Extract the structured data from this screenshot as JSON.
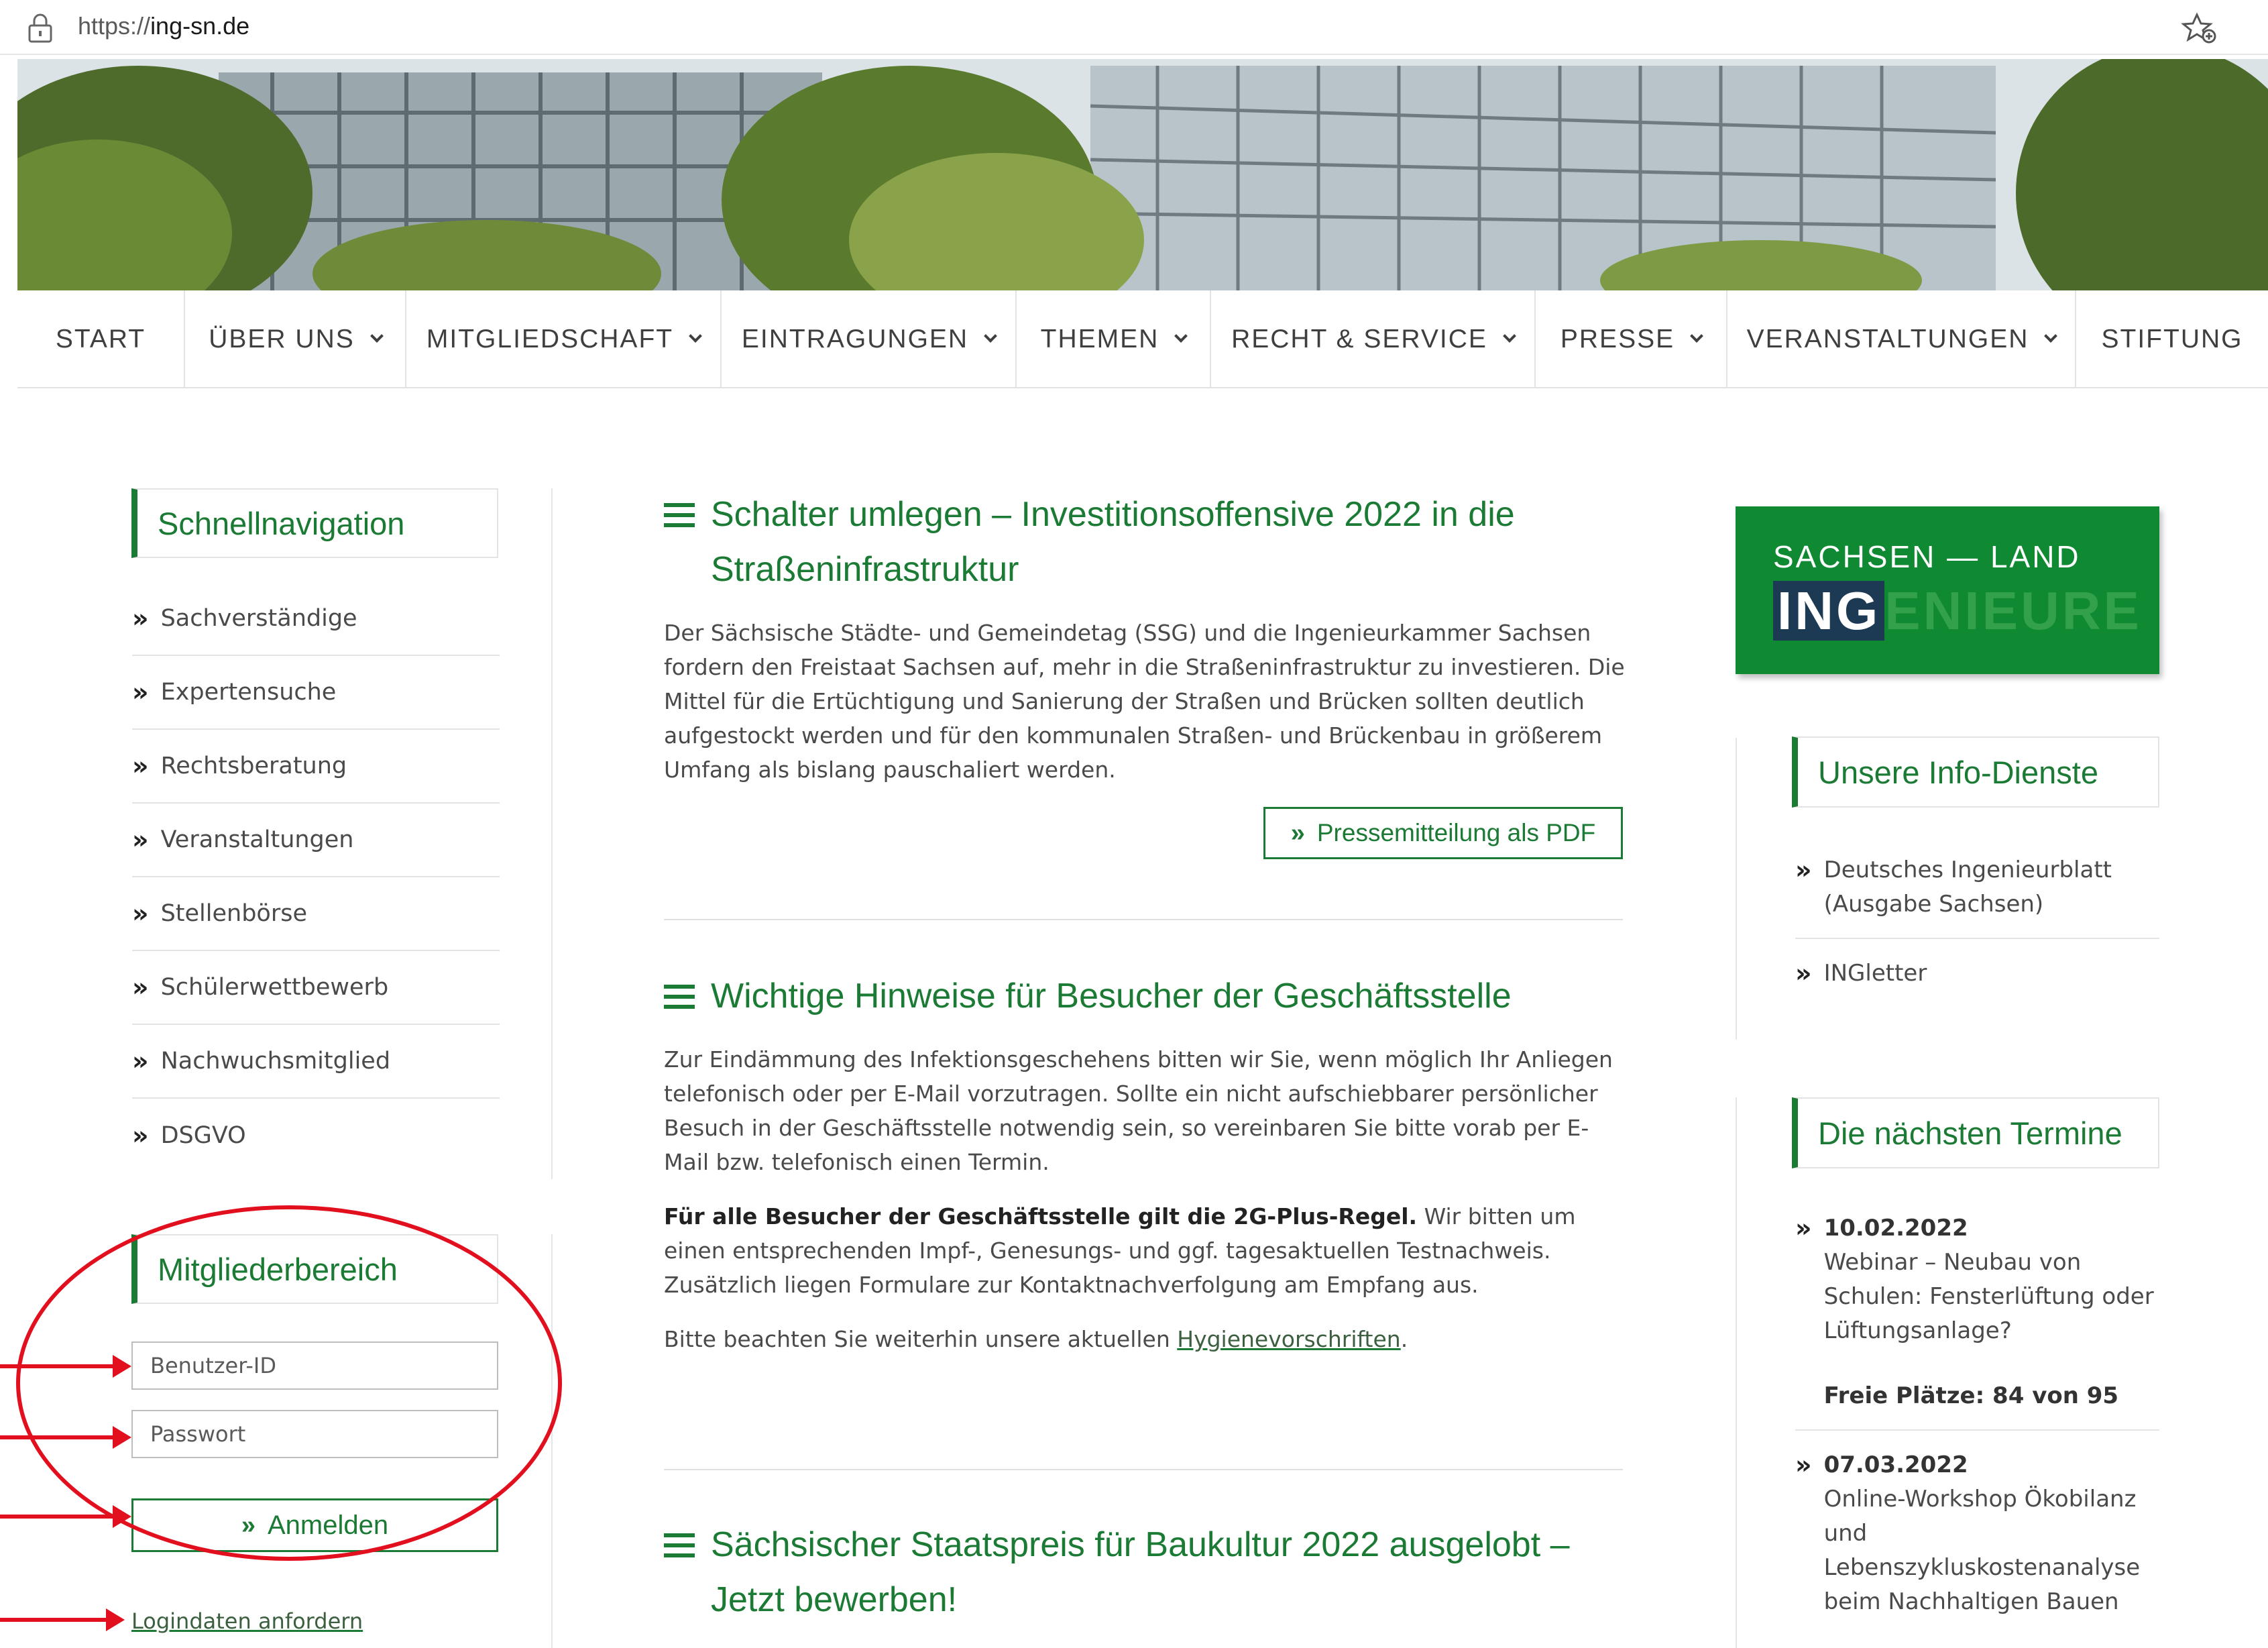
{
  "browser": {
    "url_scheme": "https://",
    "url_host": "ing-sn.de"
  },
  "nav": [
    {
      "label": "START",
      "dropdown": false
    },
    {
      "label": "ÜBER UNS",
      "dropdown": true
    },
    {
      "label": "MITGLIEDSCHAFT",
      "dropdown": true
    },
    {
      "label": "EINTRAGUNGEN",
      "dropdown": true
    },
    {
      "label": "THEMEN",
      "dropdown": true
    },
    {
      "label": "RECHT & SERVICE",
      "dropdown": true
    },
    {
      "label": "PRESSE",
      "dropdown": true
    },
    {
      "label": "VERANSTALTUNGEN",
      "dropdown": true
    },
    {
      "label": "STIFTUNG",
      "dropdown": false
    }
  ],
  "quicknav": {
    "title": "Schnellnavigation",
    "items": [
      "Sachverständige",
      "Expertensuche",
      "Rechtsberatung",
      "Veranstaltungen",
      "Stellenbörse",
      "Schülerwettbewerb",
      "Nachwuchsmitglied",
      "DSGVO"
    ]
  },
  "members": {
    "title": "Mitgliederbereich",
    "user_placeholder": "Benutzer-ID",
    "password_placeholder": "Passwort",
    "login_label": "Anmelden",
    "request_label": "Logindaten anfordern"
  },
  "articles": {
    "a1": {
      "title_line1": "Schalter umlegen – Investitionsoffensive 2022 in die",
      "title_line2": "Straßeninfrastruktur",
      "body": "Der Sächsische Städte- und Gemeindetag (SSG) und die Ingenieurkammer Sachsen fordern den Freistaat Sachsen auf, mehr in die Straßeninfrastruktur zu investieren. Die Mittel für die Ertüchtigung und Sanierung der Straßen und Brücken sollten deutlich aufgestockt werden und für den kommunalen Straßen- und Brückenbau in größerem Umfang als bislang pauschaliert werden.",
      "button": "Pressemitteilung als PDF"
    },
    "a2": {
      "title": "Wichtige Hinweise für Besucher der Geschäftsstelle",
      "p1": "Zur Eindämmung des Infektionsgeschehens bitten wir Sie, wenn möglich Ihr Anliegen telefonisch oder per E-Mail vorzutragen. Sollte ein nicht aufschiebbarer persönlicher Besuch in der Geschäftsstelle notwendig sein, so vereinbaren Sie bitte vorab per E-Mail bzw. telefonisch einen Termin.",
      "p2_bold": "Für alle Besucher der Geschäftsstelle gilt die 2G-Plus-Regel.",
      "p2_rest": " Wir bitten um einen entsprechenden Impf-, Genesungs- und ggf. tagesaktuellen Testnachweis. Zusätzlich liegen Formulare zur Kontaktnachverfolgung am Empfang aus.",
      "p3_before": "Bitte beachten Sie weiterhin unsere aktuellen ",
      "p3_link": "Hygienevorschriften",
      "p3_after": "."
    },
    "a3": {
      "title_line1": "Sächsischer Staatspreis für Baukultur 2022 ausgelobt –",
      "title_line2": "Jetzt bewerben!"
    }
  },
  "banner": {
    "line1": "SACHSEN — LAND DER",
    "ing_dark": "ING",
    "ing_light": "ENIEURE"
  },
  "info": {
    "title": "Unsere Info-Dienste",
    "items": [
      "Deutsches Ingenieurblatt (Ausgabe Sachsen)",
      "INGletter"
    ]
  },
  "events": {
    "title": "Die nächsten Termine",
    "items": [
      {
        "date": "10.02.2022",
        "text": "Webinar – Neubau von Schulen: Fensterlüftung oder Lüftungsanlage?",
        "seats": "Freie Plätze: 84 von 95"
      },
      {
        "date": "07.03.2022",
        "text": "Online-Workshop Ökobilanz und Lebenszykluskostenanalyse beim Nachhaltigen Bauen",
        "seats": ""
      }
    ]
  },
  "colors": {
    "brand_green": "#1b7a34",
    "banner_green": "#0f8a33",
    "annotation_red": "#e2101e"
  }
}
